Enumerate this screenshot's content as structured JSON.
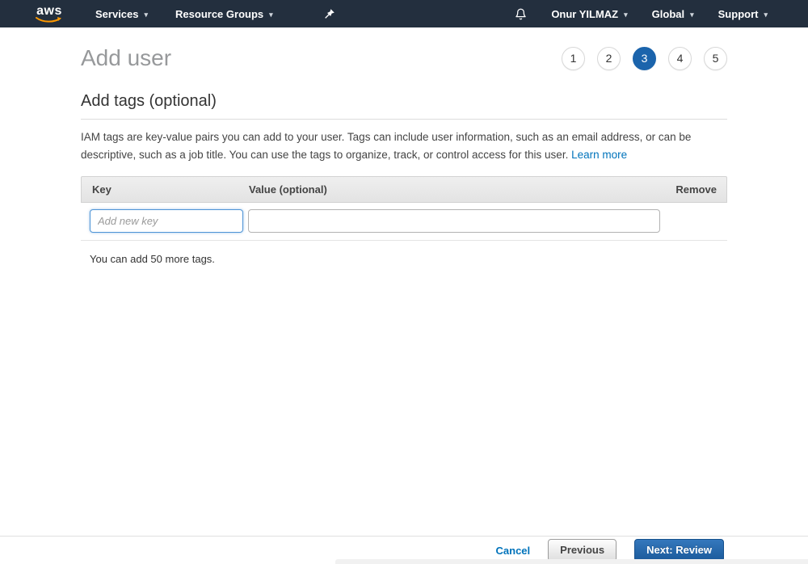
{
  "navbar": {
    "logo_text": "aws",
    "services_label": "Services",
    "resource_groups_label": "Resource Groups",
    "user_label": "Onur YILMAZ",
    "region_label": "Global",
    "support_label": "Support",
    "caret": "▾"
  },
  "page": {
    "title": "Add user",
    "steps": [
      "1",
      "2",
      "3",
      "4",
      "5"
    ],
    "active_step": "3"
  },
  "section": {
    "heading": "Add tags (optional)",
    "description": "IAM tags are key-value pairs you can add to your user. Tags can include user information, such as an email address, or can be descriptive, such as a job title. You can use the tags to organize, track, or control access for this user. ",
    "learn_more_label": "Learn more"
  },
  "tag_table": {
    "headers": {
      "key": "Key",
      "value": "Value (optional)",
      "remove": "Remove"
    },
    "row": {
      "key_value": "",
      "key_placeholder": "Add new key",
      "value_value": "",
      "value_placeholder": ""
    },
    "note": "You can add 50 more tags."
  },
  "footer": {
    "cancel_label": "Cancel",
    "previous_label": "Previous",
    "next_label": "Next: Review"
  },
  "colors": {
    "navbar_bg": "#232f3e",
    "logo_swoosh_orange": "#f90",
    "link_blue": "#0073bb",
    "active_step_blue": "#1b64ac",
    "primary_button_blue": "#1b5a9b",
    "focused_input_border": "#4f94d6"
  }
}
